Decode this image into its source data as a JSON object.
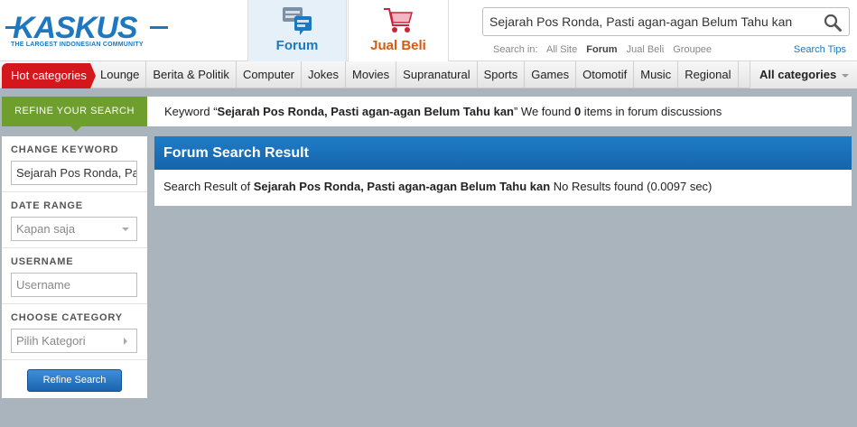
{
  "logo": {
    "text": "KASKUS",
    "tagline": "THE LARGEST INDONESIAN COMMUNITY"
  },
  "nav": {
    "forum": "Forum",
    "jual_beli": "Jual Beli"
  },
  "search": {
    "value": "Sejarah Pos Ronda, Pasti agan-agan Belum Tahu kan",
    "search_in_label": "Search in:",
    "options": [
      "All Site",
      "Forum",
      "Jual Beli",
      "Groupee"
    ],
    "active": "Forum",
    "tips": "Search Tips"
  },
  "categories": {
    "hot": "Hot categories",
    "items": [
      "Lounge",
      "Berita & Politik",
      "Computer",
      "Jokes",
      "Movies",
      "Supranatural",
      "Sports",
      "Games",
      "Otomotif",
      "Music",
      "Regional"
    ],
    "all": "All categories"
  },
  "refine": {
    "tab": "REFINE YOUR SEARCH",
    "keyword_title": "CHANGE KEYWORD",
    "keyword_value": "Sejarah Pos Ronda, Pasti agan-agan Belum Tahu kan",
    "date_title": "DATE RANGE",
    "date_value": "Kapan saja",
    "username_title": "USERNAME",
    "username_placeholder": "Username",
    "category_title": "CHOOSE CATEGORY",
    "category_value": "Pilih Kategori",
    "button": "Refine Search"
  },
  "keyword_strip": {
    "prefix": "Keyword “",
    "keyword": "Sejarah Pos Ronda, Pasti agan-agan Belum Tahu kan",
    "mid": "” We found ",
    "count": "0",
    "suffix": " items in forum discussions"
  },
  "results": {
    "title": "Forum Search Result",
    "prefix": "Search Result of ",
    "keyword": "Sejarah Pos Ronda, Pasti agan-agan Belum Tahu kan",
    "suffix": " No Results found (0.0097 sec)"
  },
  "colors": {
    "brand_blue": "#1d78c0",
    "hot_red": "#d4171c",
    "refine_green": "#6e9e2e",
    "jual_orange": "#d45b10"
  }
}
